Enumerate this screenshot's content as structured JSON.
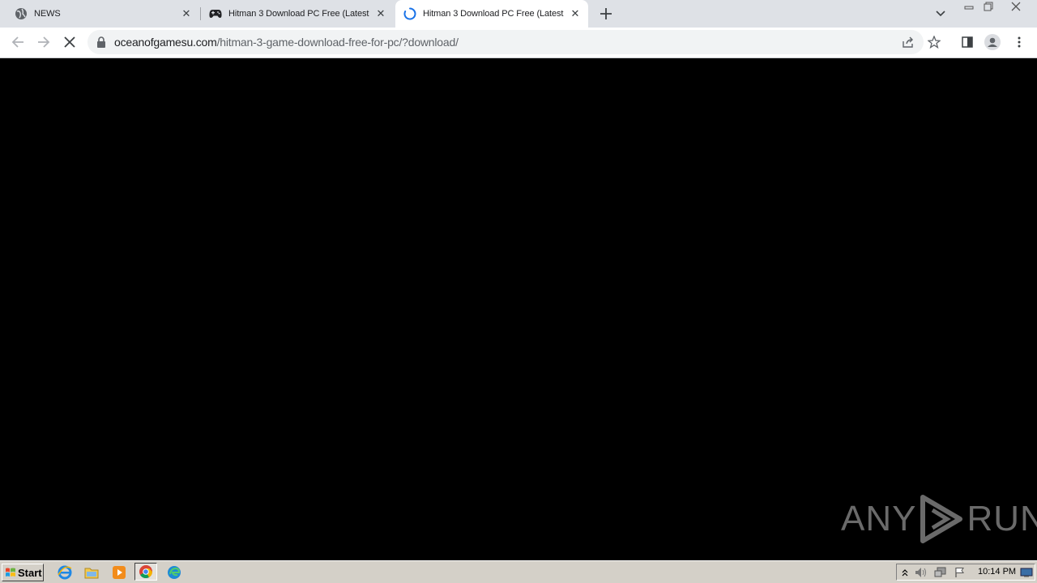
{
  "browser": {
    "tabs": [
      {
        "title": "NEWS",
        "favicon": "globe-icon",
        "active": false
      },
      {
        "title": "Hitman 3 Download PC Free (Latest",
        "favicon": "gamepad-icon",
        "active": false
      },
      {
        "title": "Hitman 3 Download PC Free (Latest",
        "favicon": "loading-spinner-icon",
        "active": true
      }
    ],
    "address_bar": {
      "host": "oceanofgamesu.com",
      "path": "/hitman-3-game-download-free-for-pc/?download/"
    }
  },
  "content": {
    "background_color": "#000000",
    "watermark": {
      "left_text": "ANY",
      "right_text": "RUN"
    }
  },
  "taskbar": {
    "start_label": "Start",
    "quick_launch": [
      "internet-explorer-icon",
      "folder-icon",
      "media-player-icon",
      "chrome-icon",
      "edge-icon"
    ],
    "clock": "10:14 PM"
  },
  "colors": {
    "tabstrip": "#dee1e6",
    "toolbar": "#ffffff",
    "omnibox": "#f1f3f4",
    "taskbar": "#d4d0c8",
    "spinner": "#1a73e8"
  }
}
